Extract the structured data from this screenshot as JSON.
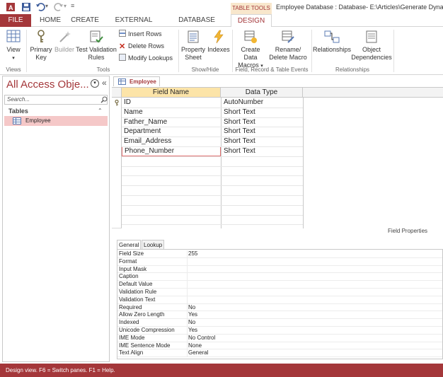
{
  "window": {
    "title": "Employee Database : Database- E:\\Articles\\Generate Dynamic",
    "contextual_tab_group": "TABLE TOOLS"
  },
  "tabs": [
    "FILE",
    "HOME",
    "CREATE",
    "EXTERNAL DATA",
    "DATABASE TOOLS",
    "DESIGN"
  ],
  "ribbon": {
    "views": {
      "view": "View",
      "group": "Views"
    },
    "tools": {
      "primary_key": "Primary Key",
      "builder": "Builder",
      "test_validation": "Test Validation Rules",
      "insert_rows": "Insert Rows",
      "delete_rows": "Delete Rows",
      "modify_lookups": "Modify Lookups",
      "group": "Tools"
    },
    "show_hide": {
      "property_sheet": "Property Sheet",
      "indexes": "Indexes",
      "group": "Show/Hide"
    },
    "field_events": {
      "create_data_macros": "Create Data Macros",
      "rename_delete_macro": "Rename/ Delete Macro",
      "group": "Field, Record & Table Events"
    },
    "relationships": {
      "relationships": "Relationships",
      "object_dependencies": "Object Dependencies",
      "group": "Relationships"
    }
  },
  "nav": {
    "title": "All Access Obje...",
    "search_placeholder": "Search...",
    "section": "Tables",
    "items": [
      "Employee"
    ]
  },
  "document": {
    "tab": "Employee",
    "columns": [
      "Field Name",
      "Data Type"
    ],
    "rows": [
      {
        "field": "ID",
        "type": "AutoNumber",
        "primary_key": true
      },
      {
        "field": "Name",
        "type": "Short Text"
      },
      {
        "field": "Father_Name",
        "type": "Short Text"
      },
      {
        "field": "Department",
        "type": "Short Text"
      },
      {
        "field": "Email_Address",
        "type": "Short Text"
      },
      {
        "field": "Phone_Number",
        "type": "Short Text"
      }
    ],
    "field_properties_label": "Field Properties",
    "property_tabs": [
      "General",
      "Lookup"
    ],
    "properties": [
      [
        "Field Size",
        "255"
      ],
      [
        "Format",
        ""
      ],
      [
        "Input Mask",
        ""
      ],
      [
        "Caption",
        ""
      ],
      [
        "Default Value",
        ""
      ],
      [
        "Validation Rule",
        ""
      ],
      [
        "Validation Text",
        ""
      ],
      [
        "Required",
        "No"
      ],
      [
        "Allow Zero Length",
        "Yes"
      ],
      [
        "Indexed",
        "No"
      ],
      [
        "Unicode Compression",
        "Yes"
      ],
      [
        "IME Mode",
        "No Control"
      ],
      [
        "IME Sentence Mode",
        "None"
      ],
      [
        "Text Align",
        "General"
      ]
    ]
  },
  "status": "Design view.  F6 = Switch panes.  F1 = Help.",
  "colors": {
    "accent": "#a4373a",
    "nav_selected": "#f5c8c8",
    "header_highlight": "#fce4a8",
    "contextual": "#f8e7cc"
  }
}
